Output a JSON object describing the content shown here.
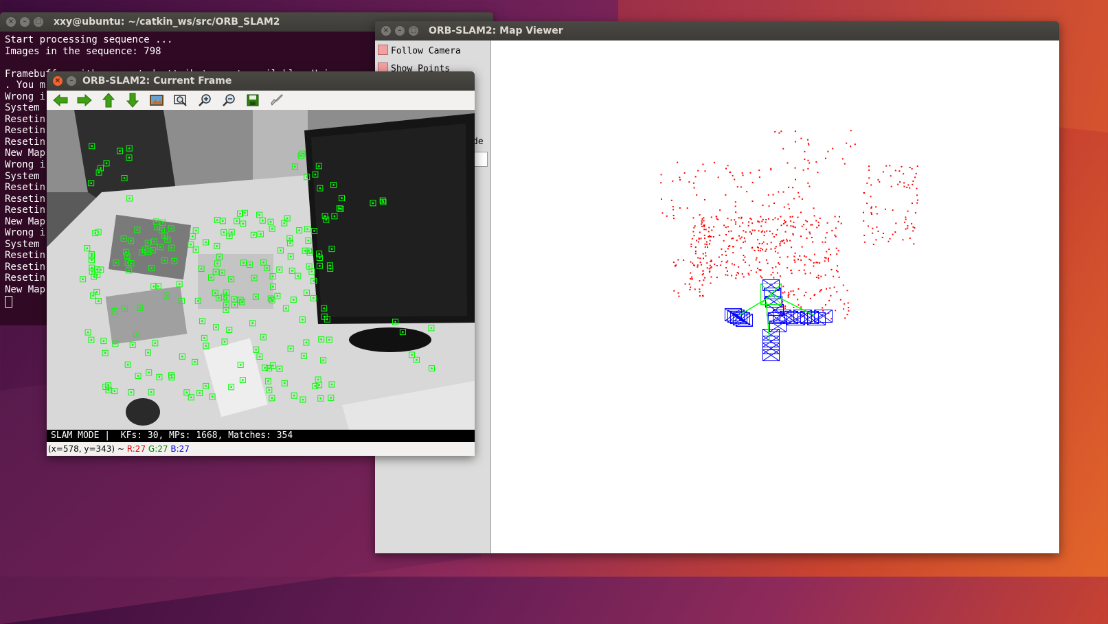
{
  "terminal": {
    "title": "xxy@ubuntu: ~/catkin_ws/src/ORB_SLAM2",
    "lines": [
      "Start processing sequence ...",
      "Images in the sequence: 798",
      "",
      "Framebuffer with requested attributes not available. Using ava",
      ". You m",
      "Wrong i",
      "System ",
      "Resetin",
      "Resetin",
      "Resetin",
      "New Map",
      "Wrong i",
      "System ",
      "Resetin",
      "Resetin",
      "Resetin",
      "New Map",
      "Wrong i",
      "System ",
      "Resetin",
      "Resetin",
      "Resetin",
      "New Map"
    ]
  },
  "map_viewer": {
    "title": "ORB-SLAM2: Map Viewer",
    "follow_camera": "Follow Camera",
    "show_points": "Show Points",
    "partial_label": "de",
    "point_color": "#ff0000",
    "keyframe_color": "#0000ff",
    "current_camera_color": "#00ff00"
  },
  "current_frame": {
    "title": "ORB-SLAM2: Current Frame",
    "toolbar": [
      "arrow-left-icon",
      "arrow-right-icon",
      "arrow-up-icon",
      "arrow-down-icon",
      "image-icon",
      "zoom-fit-icon",
      "zoom-in-icon",
      "zoom-out-icon",
      "save-icon",
      "brush-icon"
    ],
    "status": "SLAM MODE |  KFs: 30, MPs: 1668, Matches: 354",
    "coords_prefix": "(x=578, y=343) ~ ",
    "r_label": "R:27",
    "g_label": "G:27",
    "b_label": "B:27",
    "feature_color": "#00ff00"
  }
}
